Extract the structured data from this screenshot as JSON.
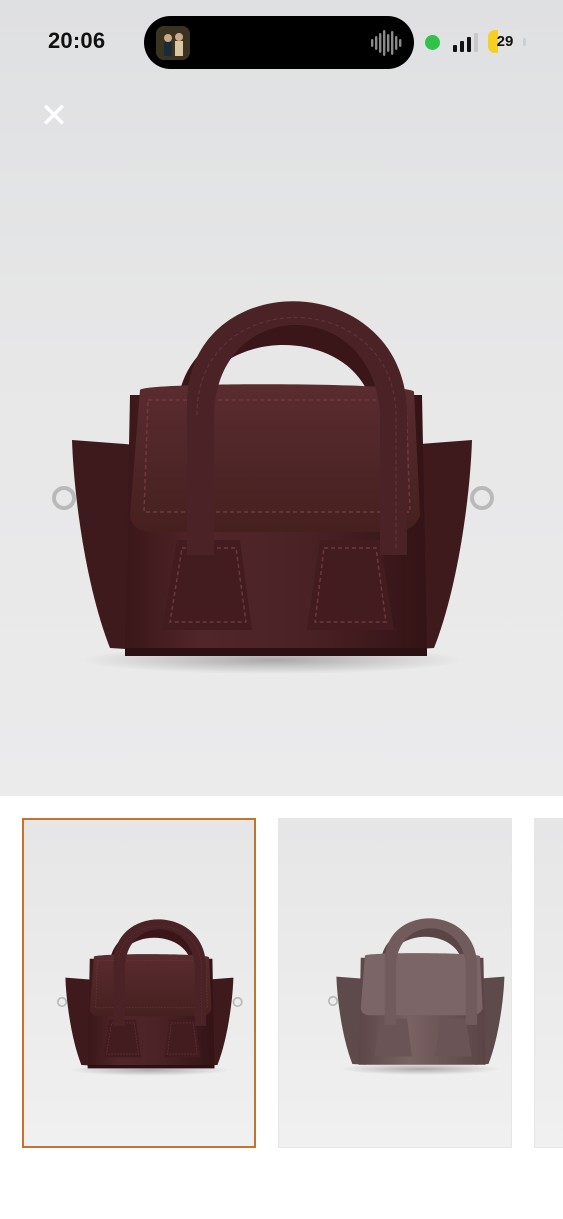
{
  "status_bar": {
    "time": "20:06",
    "battery_level": "29",
    "battery_fraction": 0.29,
    "icons": [
      "now-playing-thumbnail-icon",
      "audio-waveform-icon",
      "camera-in-use-dot-icon",
      "cellular-signal-icon",
      "battery-icon"
    ]
  },
  "viewer": {
    "close_icon": "close-icon",
    "main_image_description_icon": "handbag-photo"
  },
  "gallery": {
    "thumbnails": [
      {
        "state": "selected",
        "color": "#4a2124"
      },
      {
        "state": "unselected",
        "color": "#6b5354"
      },
      {
        "state": "unselected",
        "color": "#5a3a3a"
      }
    ],
    "selected_border_color": "#c4732d"
  },
  "colors": {
    "bag_main": "#4a2124",
    "bag_alt": "#6b5354",
    "accent": "#c4732d",
    "camera_dot": "#31c24a",
    "battery_fill": "#f7cf20"
  }
}
